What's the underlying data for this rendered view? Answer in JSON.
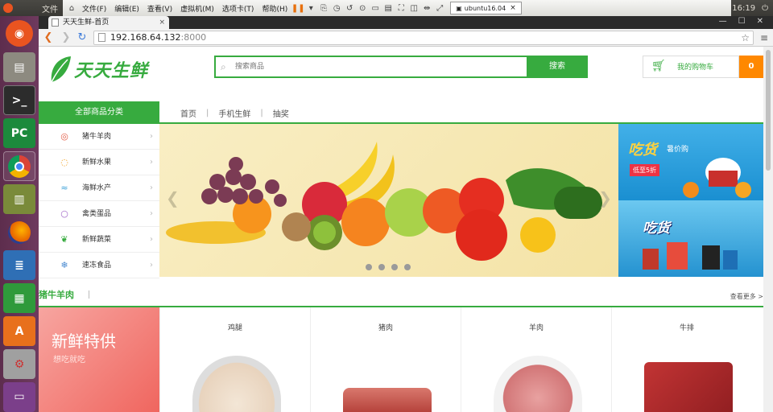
{
  "os": {
    "panel_app": "文件",
    "time": "16:19",
    "vm_menu": [
      "文件(F)",
      "编辑(E)",
      "查看(V)",
      "虚拟机(M)",
      "选项卡(T)",
      "帮助(H)"
    ],
    "vm_tab": "ubuntu16.04"
  },
  "browser": {
    "tab_title": "天天生鲜-首页",
    "url_host": "192.168.64.132",
    "url_port": ":8000"
  },
  "site": {
    "logo_text": "天天生鲜",
    "search_placeholder": "搜索商品",
    "search_button": "搜索",
    "cart_label": "我的购物车",
    "cart_count": "0",
    "all_categories": "全部商品分类",
    "nav_links": [
      "首页",
      "手机生鲜",
      "抽奖"
    ],
    "categories": [
      {
        "label": "猪牛羊肉",
        "icon": "meat-icon",
        "glyph": "◎",
        "color": "#e25b45"
      },
      {
        "label": "新鲜水果",
        "icon": "fruit-icon",
        "glyph": "◌",
        "color": "#f0a020"
      },
      {
        "label": "海鲜水产",
        "icon": "seafood-icon",
        "glyph": "≈",
        "color": "#3ba0d8"
      },
      {
        "label": "禽类蛋品",
        "icon": "egg-icon",
        "glyph": "○",
        "color": "#a065c8"
      },
      {
        "label": "新鲜蔬菜",
        "icon": "vegetable-icon",
        "glyph": "❦",
        "color": "#37ab3f"
      },
      {
        "label": "速冻食品",
        "icon": "frozen-icon",
        "glyph": "❄",
        "color": "#4a8ad0"
      }
    ],
    "promo1_title": "吃货",
    "promo1_sub": "暑价购",
    "promo1_badge": "低至5折",
    "promo2_title": "吃货",
    "section_title": "猪牛羊肉",
    "more_link": "查看更多 >",
    "banner_title": "新鲜特供",
    "banner_sub": "想吃就吃",
    "products": [
      {
        "name": "鸡腿"
      },
      {
        "name": "猪肉"
      },
      {
        "name": "羊肉"
      },
      {
        "name": "牛排"
      }
    ]
  }
}
